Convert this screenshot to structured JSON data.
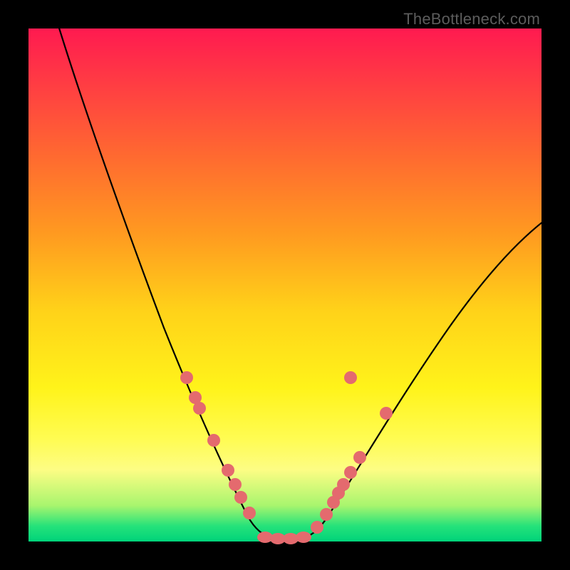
{
  "watermark": "TheBottleneck.com",
  "chart_data": {
    "type": "line",
    "title": "",
    "xlabel": "",
    "ylabel": "",
    "xlim": [
      0,
      100
    ],
    "ylim": [
      0,
      100
    ],
    "background_gradient": {
      "top": "#ff1a50",
      "middle": "#fff31a",
      "bottom": "#00d37a"
    },
    "series": [
      {
        "name": "bottleneck-curve",
        "description": "V-shaped bottleneck curve; y=0 is optimal (green), high y is severe bottleneck (red)",
        "x": [
          0,
          5,
          10,
          15,
          20,
          25,
          28,
          30,
          33,
          36,
          40,
          43,
          45,
          47,
          50,
          53,
          55,
          58,
          62,
          68,
          75,
          82,
          90,
          100
        ],
        "y": [
          112,
          100,
          86,
          72,
          58,
          44,
          36,
          30,
          23,
          16,
          8,
          3,
          1,
          0,
          0,
          0,
          1,
          5,
          12,
          23,
          35,
          46,
          56,
          65
        ]
      }
    ],
    "markers": {
      "description": "Salmon dots marking sampled component pairings along the curve near the minimum",
      "points_left": [
        {
          "x": 28,
          "y": 36
        },
        {
          "x": 30,
          "y": 30
        },
        {
          "x": 33,
          "y": 23
        },
        {
          "x": 35,
          "y": 18
        },
        {
          "x": 38,
          "y": 12
        },
        {
          "x": 40,
          "y": 8
        },
        {
          "x": 42,
          "y": 4
        }
      ],
      "points_right": [
        {
          "x": 55,
          "y": 1
        },
        {
          "x": 57,
          "y": 3
        },
        {
          "x": 58,
          "y": 5
        },
        {
          "x": 59,
          "y": 7
        },
        {
          "x": 60,
          "y": 9
        },
        {
          "x": 62,
          "y": 12
        },
        {
          "x": 63,
          "y": 15
        },
        {
          "x": 67,
          "y": 22
        }
      ],
      "flat_segment": {
        "x_start": 44,
        "x_end": 53,
        "y": 0
      }
    }
  }
}
